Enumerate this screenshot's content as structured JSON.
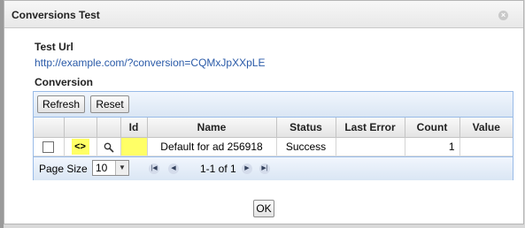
{
  "dialog": {
    "title": "Conversions Test",
    "close_icon": "close-icon"
  },
  "test_url": {
    "label": "Test Url",
    "value": "http://example.com/?conversion=CQMxJpXXpLE"
  },
  "conversion": {
    "label": "Conversion",
    "toolbar": {
      "refresh_label": "Refresh",
      "reset_label": "Reset"
    },
    "columns": [
      "",
      "",
      "",
      "Id",
      "Name",
      "Status",
      "Last Error",
      "Count",
      "Value"
    ],
    "rows": [
      {
        "checked": false,
        "code_icon": "<>",
        "search_icon": "search-icon",
        "id": "",
        "name": "Default for ad 256918",
        "status": "Success",
        "last_error": "",
        "count": "1",
        "value": ""
      }
    ],
    "pager": {
      "page_size_label": "Page Size",
      "page_size_value": "10",
      "info": "1-1 of 1"
    }
  },
  "footer": {
    "ok_label": "OK"
  },
  "colors": {
    "highlight": "#ffff66",
    "link": "#2a5aa8",
    "grid_border": "#99bbe8"
  }
}
